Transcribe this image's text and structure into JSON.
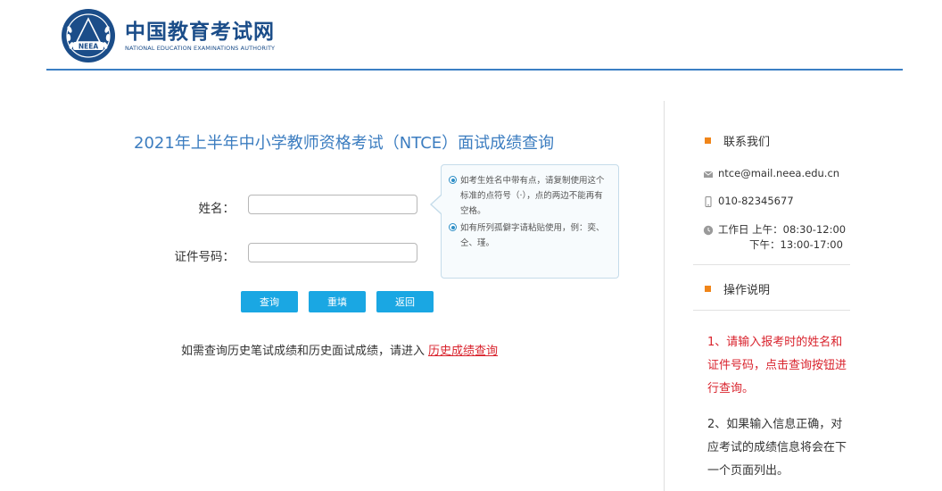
{
  "header": {
    "org_cn": "中国教育考试网",
    "org_en": "NATIONAL EDUCATION EXAMINATIONS AUTHORITY",
    "emblem_text": "NEEA"
  },
  "form": {
    "title": "2021年上半年中小学教师资格考试（NTCE）面试成绩查询",
    "name_label": "姓名：",
    "id_label": "证件号码：",
    "name_value": "",
    "id_value": "",
    "hints": [
      "如考生姓名中带有点，请复制使用这个标准的点符号（·），点的两边不能再有空格。",
      "如有所列孤僻字请粘贴使用，例：奕、仝、瑾。"
    ],
    "buttons": {
      "query": "查询",
      "reset": "重填",
      "back": "返回"
    },
    "history_text": "如需查询历史笔试成绩和历史面试成绩，请进入",
    "history_link": "历史成绩查询"
  },
  "sidebar": {
    "contact_title": "联系我们",
    "email": "ntce@mail.neea.edu.cn",
    "phone": "010-82345677",
    "hours_line1": "工作日 上午：08:30-12:00",
    "hours_line2": "下午：13:00-17:00",
    "ops_title": "操作说明",
    "instructions": [
      "1、请输入报考时的姓名和证件号码，点击查询按钮进行查询。",
      "2、如果输入信息正确，对应考试的成绩信息将会在下一个页面列出。"
    ]
  },
  "colors": {
    "brand_blue": "#1b4d89",
    "title_blue": "#3c7dc0",
    "button_blue": "#1aa7e3",
    "accent_orange": "#f08519",
    "link_red": "#d9232d"
  },
  "icons": {
    "emblem": "neea-emblem-icon",
    "email": "envelope-icon",
    "phone": "mobile-phone-icon",
    "hours": "clock-icon",
    "hint_bullet": "radio-bullet-icon"
  }
}
